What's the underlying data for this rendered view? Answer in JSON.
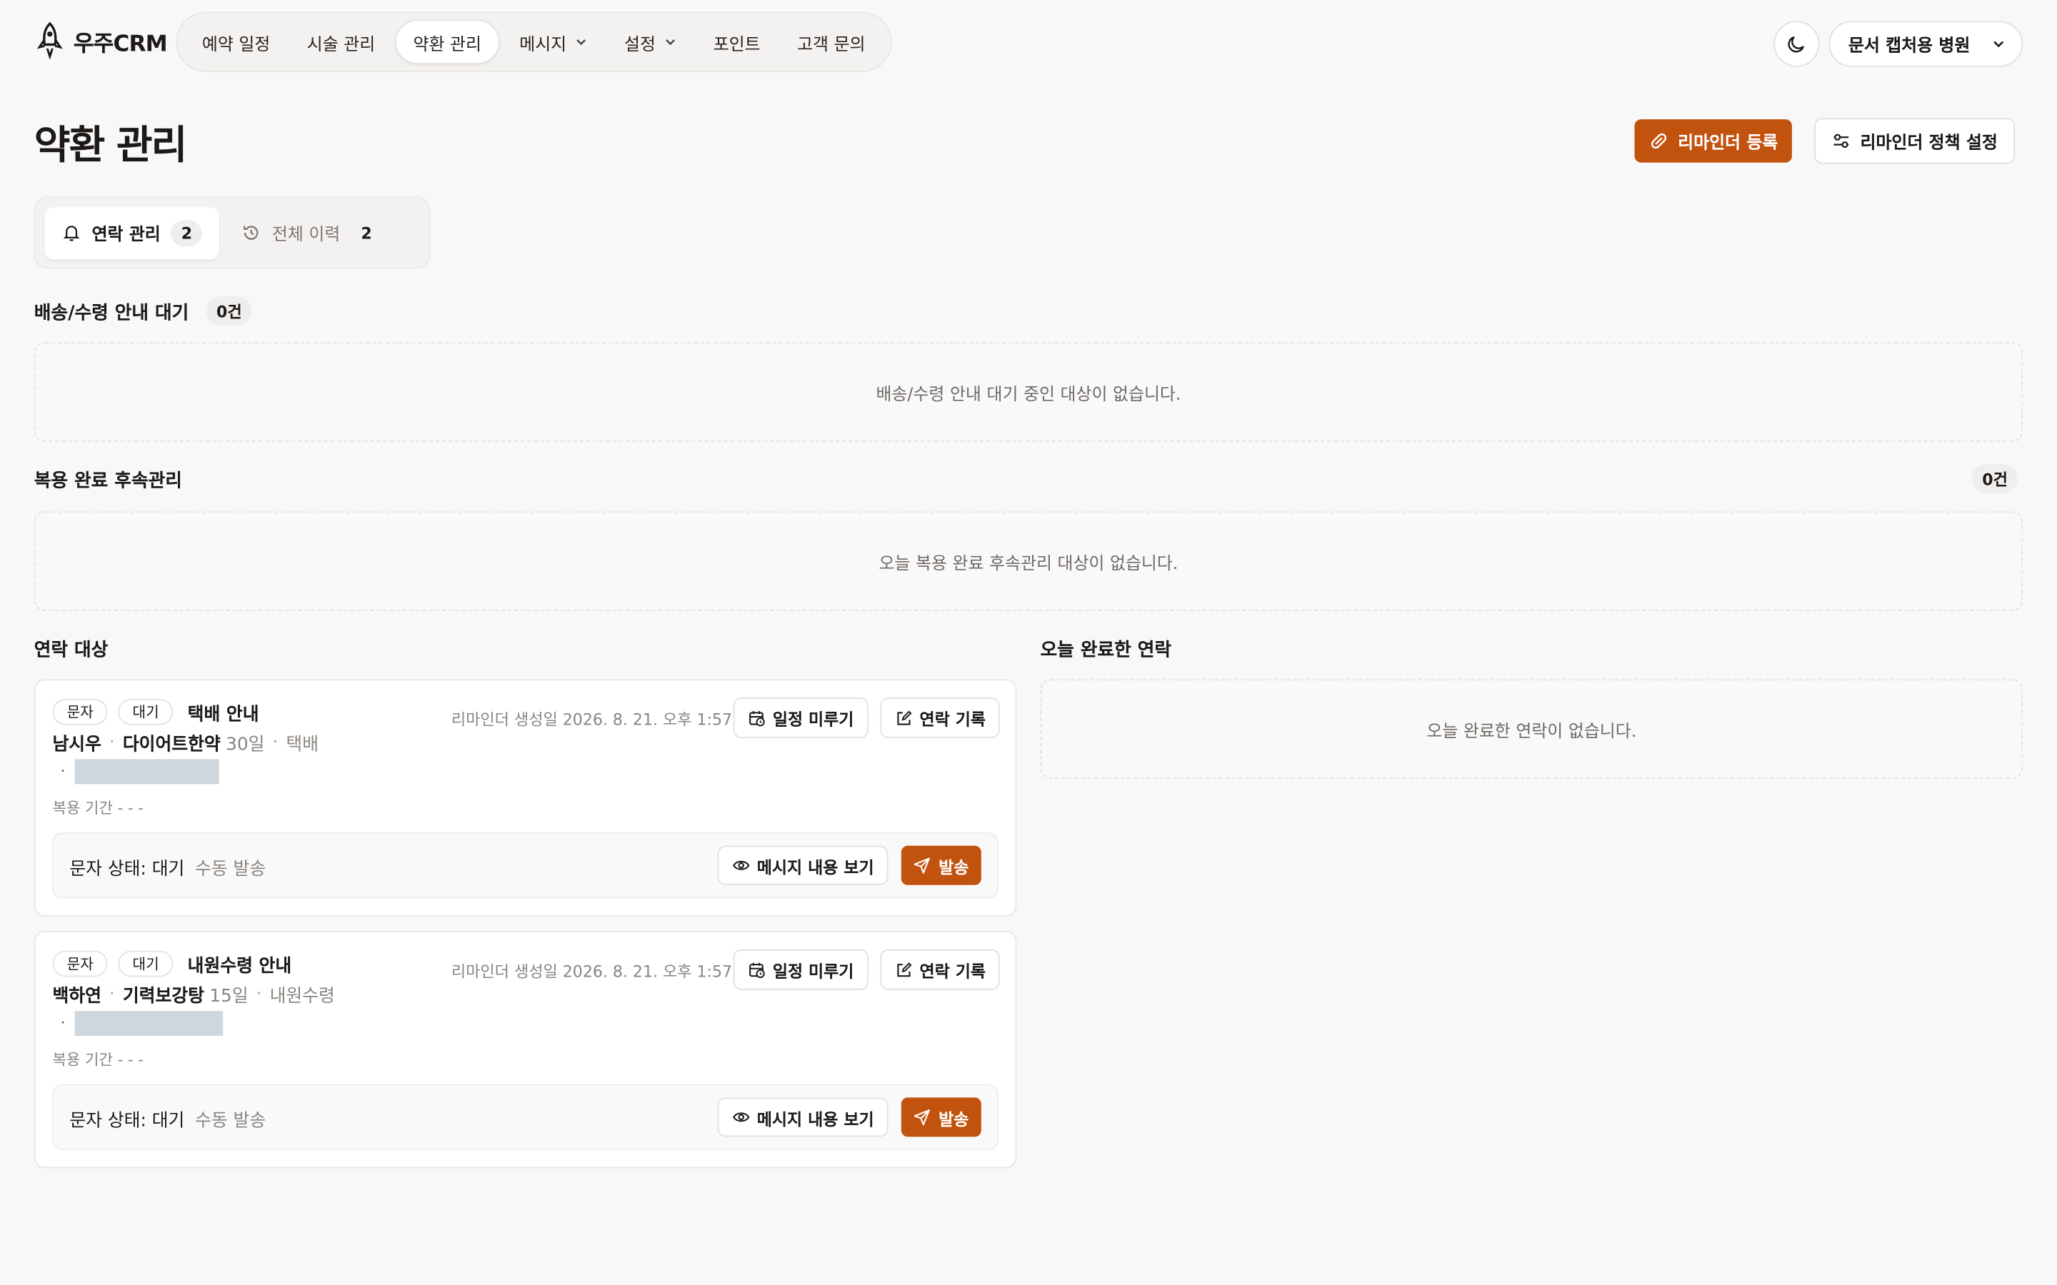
{
  "app": {
    "name": "우주CRM"
  },
  "nav": {
    "items": [
      {
        "label": "예약 일정"
      },
      {
        "label": "시술 관리"
      },
      {
        "label": "약환 관리"
      },
      {
        "label": "메시지"
      },
      {
        "label": "설정"
      },
      {
        "label": "포인트"
      },
      {
        "label": "고객 문의"
      }
    ]
  },
  "header": {
    "clinic": "문서 캡처용 병원"
  },
  "page": {
    "title": "약환 관리",
    "register_button": "리마인더 등록",
    "policy_button": "리마인더 정책 설정"
  },
  "tabs": [
    {
      "label": "연락 관리",
      "count": "2"
    },
    {
      "label": "전체 이력",
      "count": "2"
    }
  ],
  "delivery": {
    "title": "배송/수령 안내 대기",
    "count": "0건",
    "empty": "배송/수령 안내 대기 중인 대상이 없습니다."
  },
  "followup": {
    "title": "복용 완료 후속관리",
    "count": "0건",
    "empty": "오늘 복용 완료 후속관리 대상이 없습니다."
  },
  "contacts": {
    "title": "연락 대상",
    "items": [
      {
        "channel": "문자",
        "status": "대기",
        "type": "택배 안내",
        "patient": "남시우",
        "medicine": "다이어트한약",
        "days": "30일",
        "method": "택배",
        "period": "복용 기간 - - -",
        "created": "리마인더 생성일 2026. 8. 21. 오후 1:57",
        "postpone": "일정 미루기",
        "record": "연락 기록",
        "sms_status": "문자 상태: 대기",
        "manual": "수동 발송",
        "view_message": "메시지 내용 보기",
        "send": "발송"
      },
      {
        "channel": "문자",
        "status": "대기",
        "type": "내원수령 안내",
        "patient": "백하연",
        "medicine": "기력보강탕",
        "days": "15일",
        "method": "내원수령",
        "period": "복용 기간 - - -",
        "created": "리마인더 생성일 2026. 8. 21. 오후 1:57",
        "postpone": "일정 미루기",
        "record": "연락 기록",
        "sms_status": "문자 상태: 대기",
        "manual": "수동 발송",
        "view_message": "메시지 내용 보기",
        "send": "발송"
      }
    ]
  },
  "completed": {
    "title": "오늘 완료한 연락",
    "empty": "오늘 완료한 연락이 없습니다."
  },
  "colors": {
    "accent": "#c2530f",
    "background": "#f9f8f8",
    "redacted": "#cfd6de"
  }
}
